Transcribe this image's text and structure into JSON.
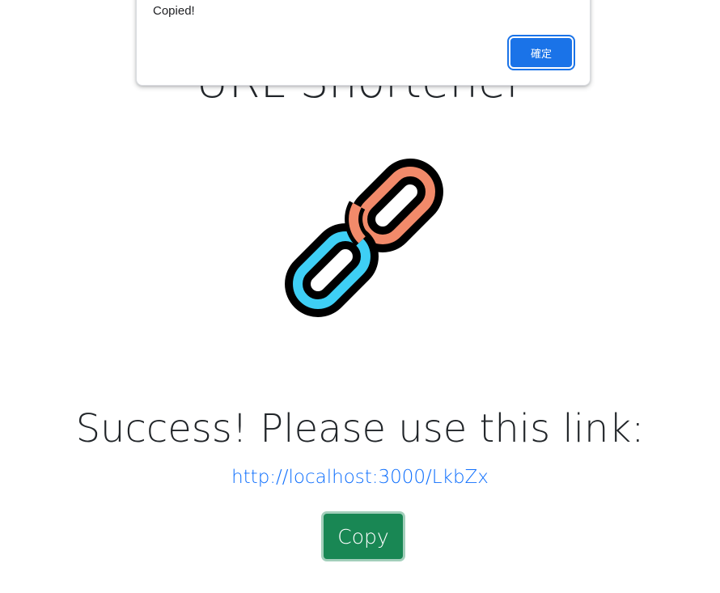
{
  "page": {
    "title": "URL Shortener",
    "logo_icon": "chain-link-icon",
    "success_heading": "Success! Please use this link:",
    "short_url": "http://localhost:3000/LkbZx",
    "copy_label": "Copy"
  },
  "dialog": {
    "message": "Copied!",
    "ok_label": "確定"
  },
  "colors": {
    "link_orange": "#f28a6a",
    "link_blue": "#3ecff5",
    "outline": "#000000",
    "copy_green": "#198754",
    "link_text": "#0d6efd",
    "dialog_button": "#1a73e8"
  }
}
